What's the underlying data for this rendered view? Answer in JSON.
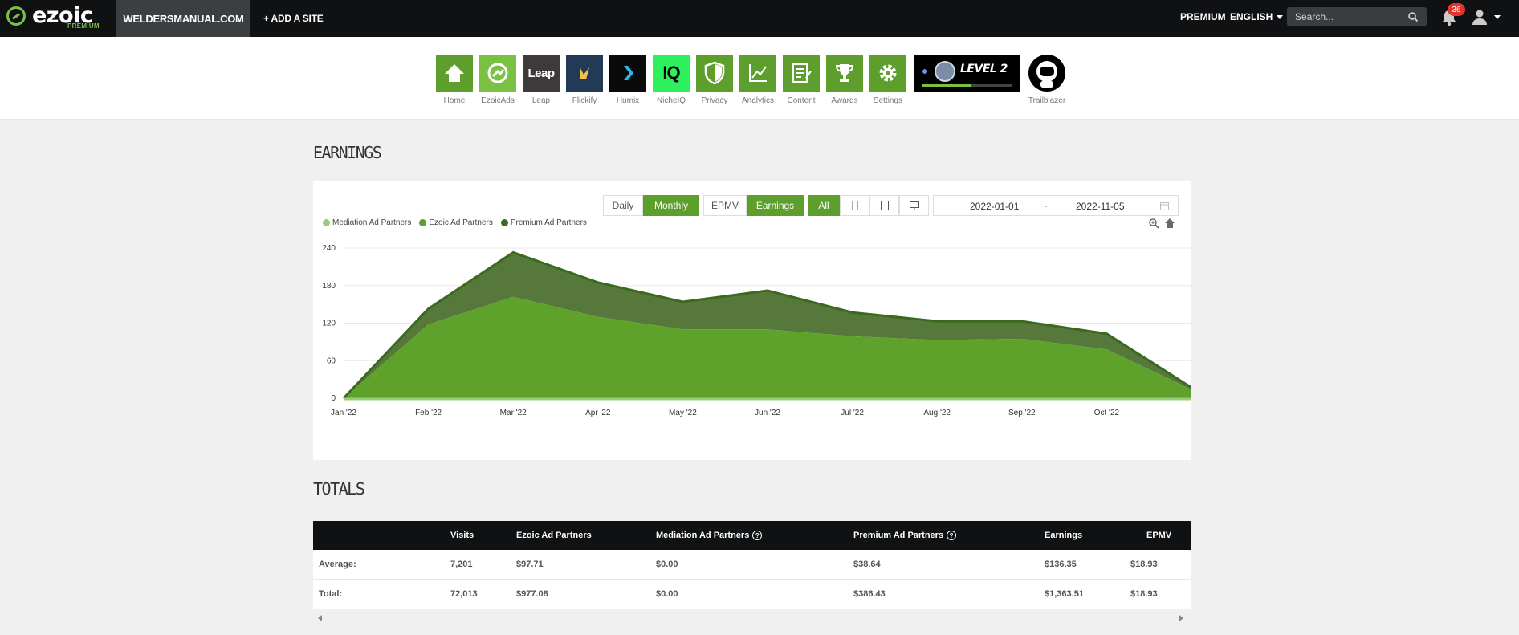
{
  "topbar": {
    "logo_text": "ezoic",
    "logo_sub": "PREMIUM",
    "site_name": "WELDERSMANUAL.COM",
    "add_site": "+ ADD A SITE",
    "premium": "PREMIUM",
    "language": "ENGLISH",
    "search_placeholder": "Search...",
    "notification_count": "36"
  },
  "apps": [
    {
      "label": "Home",
      "icon": "home-icon"
    },
    {
      "label": "EzoicAds",
      "icon": "ezoicads-icon"
    },
    {
      "label": "Leap",
      "icon": "leap-icon",
      "tile_text": "Leap"
    },
    {
      "label": "Flickify",
      "icon": "flickify-icon"
    },
    {
      "label": "Humix",
      "icon": "humix-icon"
    },
    {
      "label": "NicheIQ",
      "icon": "nicheiq-icon",
      "tile_text": "IQ"
    },
    {
      "label": "Privacy",
      "icon": "shield-icon"
    },
    {
      "label": "Analytics",
      "icon": "analytics-icon"
    },
    {
      "label": "Content",
      "icon": "content-icon"
    },
    {
      "label": "Awards",
      "icon": "trophy-icon"
    },
    {
      "label": "Settings",
      "icon": "gear-icon"
    }
  ],
  "level": {
    "label": "LEVEL 2",
    "progress": 0.55
  },
  "trailblazer": {
    "label": "Trailblazer"
  },
  "earnings": {
    "title": "EARNINGS",
    "period_buttons": [
      "Daily",
      "Monthly"
    ],
    "metric_buttons": [
      "EPMV",
      "Earnings"
    ],
    "device_all": "All",
    "date_from": "2022-01-01",
    "date_sep": "~",
    "date_to": "2022-11-05"
  },
  "chart_data": {
    "type": "area",
    "stacked": true,
    "categories": [
      "Jan '22",
      "Feb '22",
      "Mar '22",
      "Apr '22",
      "May '22",
      "Jun '22",
      "Jul '22",
      "Aug '22",
      "Sep '22",
      "Oct '22",
      ""
    ],
    "yticks": [
      0,
      60,
      120,
      180,
      240
    ],
    "ylim": [
      0,
      240
    ],
    "legend_position": "top-left",
    "grid": true,
    "series": [
      {
        "name": "Mediation Ad Partners",
        "color": "#9acd7a",
        "values": [
          0,
          0,
          0,
          0,
          0,
          0,
          0,
          0,
          0,
          0,
          0
        ]
      },
      {
        "name": "Ezoic Ad Partners",
        "color": "#5e9e2d",
        "values": [
          0,
          118,
          162,
          130,
          110,
          110,
          99,
          93,
          95,
          78,
          14
        ]
      },
      {
        "name": "Premium Ad Partners",
        "color": "#557a3a",
        "values": [
          0,
          25,
          71,
          55,
          44,
          62,
          38,
          30,
          28,
          25,
          3
        ]
      }
    ],
    "line_color": "#3b6a1f"
  },
  "totals": {
    "title": "TOTALS",
    "headers": [
      "",
      "Visits",
      "Ezoic Ad Partners",
      "Mediation Ad Partners",
      "Premium Ad Partners",
      "Earnings",
      "EPMV"
    ],
    "rows": [
      [
        "Average:",
        "7,201",
        "$97.71",
        "$0.00",
        "$38.64",
        "$136.35",
        "$18.93"
      ],
      [
        "Total:",
        "72,013",
        "$977.08",
        "$0.00",
        "$386.43",
        "$1,363.51",
        "$18.93"
      ]
    ]
  },
  "colors": {
    "brand_green": "#5e9e2d",
    "accent_green": "#7ac143",
    "topbar": "#0f1113"
  }
}
